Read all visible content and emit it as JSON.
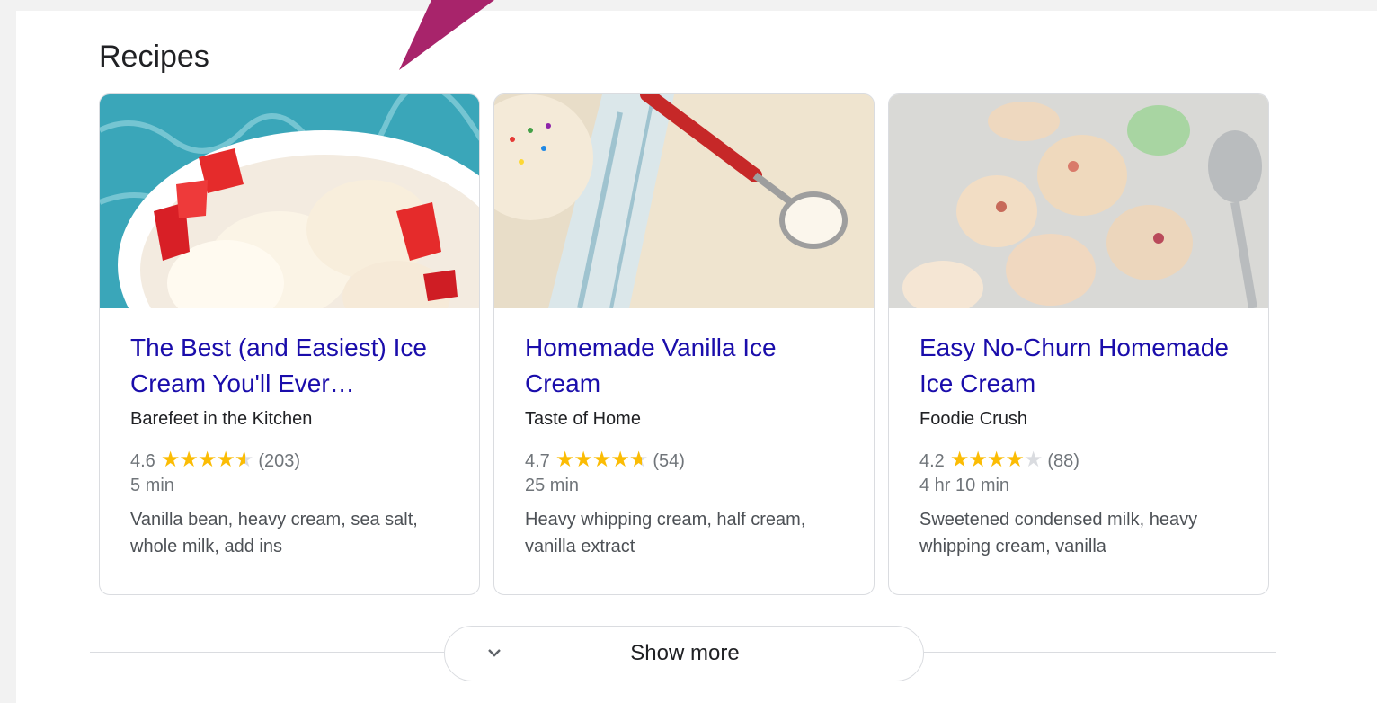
{
  "section": {
    "title": "Recipes"
  },
  "cards": [
    {
      "title": "The Best (and Easiest) Ice Cream You'll Ever…",
      "source": "Barefeet in the Kitchen",
      "rating": "4.6",
      "rating_value": 4.6,
      "reviews": "(203)",
      "time": "5 min",
      "ingredients": "Vanilla bean, heavy cream, sea salt, whole milk, add ins"
    },
    {
      "title": "Homemade Vanilla Ice Cream",
      "source": "Taste of Home",
      "rating": "4.7",
      "rating_value": 4.7,
      "reviews": "(54)",
      "time": "25 min",
      "ingredients": "Heavy whipping cream, half cream, vanilla extract"
    },
    {
      "title": "Easy No-Churn Homemade Ice Cream",
      "source": "Foodie Crush",
      "rating": "4.2",
      "rating_value": 4.2,
      "reviews": "(88)",
      "time": "4 hr 10 min",
      "ingredients": "Sweetened condensed milk, heavy whipping cream, vanilla"
    }
  ],
  "show_more": {
    "label": "Show more",
    "icon": "chevron-down-icon"
  },
  "colors": {
    "link": "#1a0dab",
    "star": "#fbbc04",
    "arrow": "#a8246b"
  }
}
